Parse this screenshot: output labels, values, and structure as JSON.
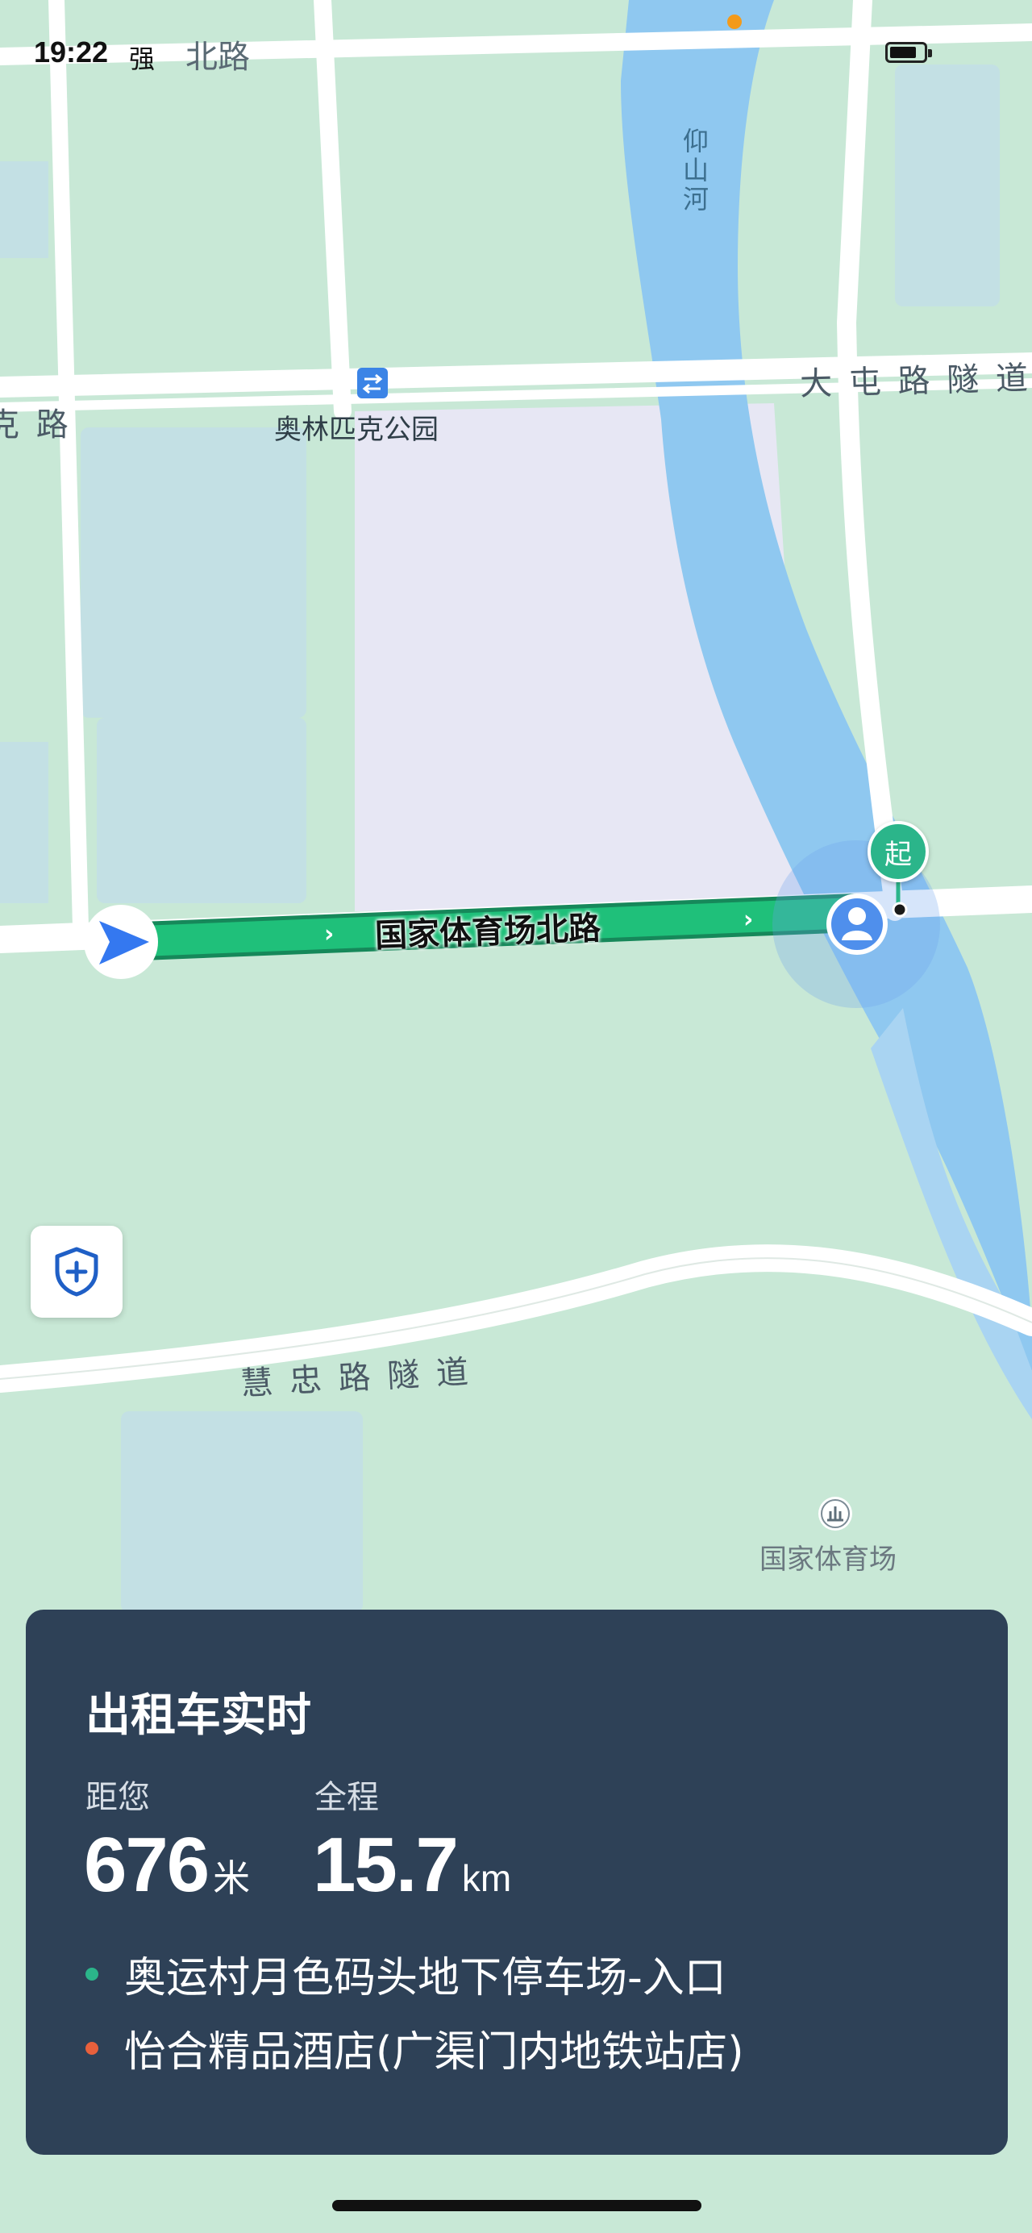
{
  "status_bar": {
    "time": "19:22",
    "app_icon": "强"
  },
  "map": {
    "streets": {
      "north_road": "北路",
      "datun_tunnel": "大 屯 路 隧 道",
      "left_road_fragment": "克 路",
      "huizhong_tunnel": "慧 忠 路 隧 道",
      "route_road": "国家体育场北路"
    },
    "river": "仰山河",
    "subway_station": "奥林匹克公园",
    "poi": "国家体育场",
    "start_badge": "起",
    "colors": {
      "route": "#1fc07a",
      "river": "#8fc8f0",
      "park": "#c8e8d6",
      "block": "#e8e8f5"
    }
  },
  "panel": {
    "title": "出租车实时",
    "distance_label": "距您",
    "distance_value": "676",
    "distance_unit": "米",
    "total_label": "全程",
    "total_value": "15.7",
    "total_unit": "km",
    "origin": "奥运村月色码头地下停车场-入口",
    "destination": "怡合精品酒店(广渠门内地铁站店)",
    "origin_color": "#2bb58a",
    "destination_color": "#e8603c"
  }
}
